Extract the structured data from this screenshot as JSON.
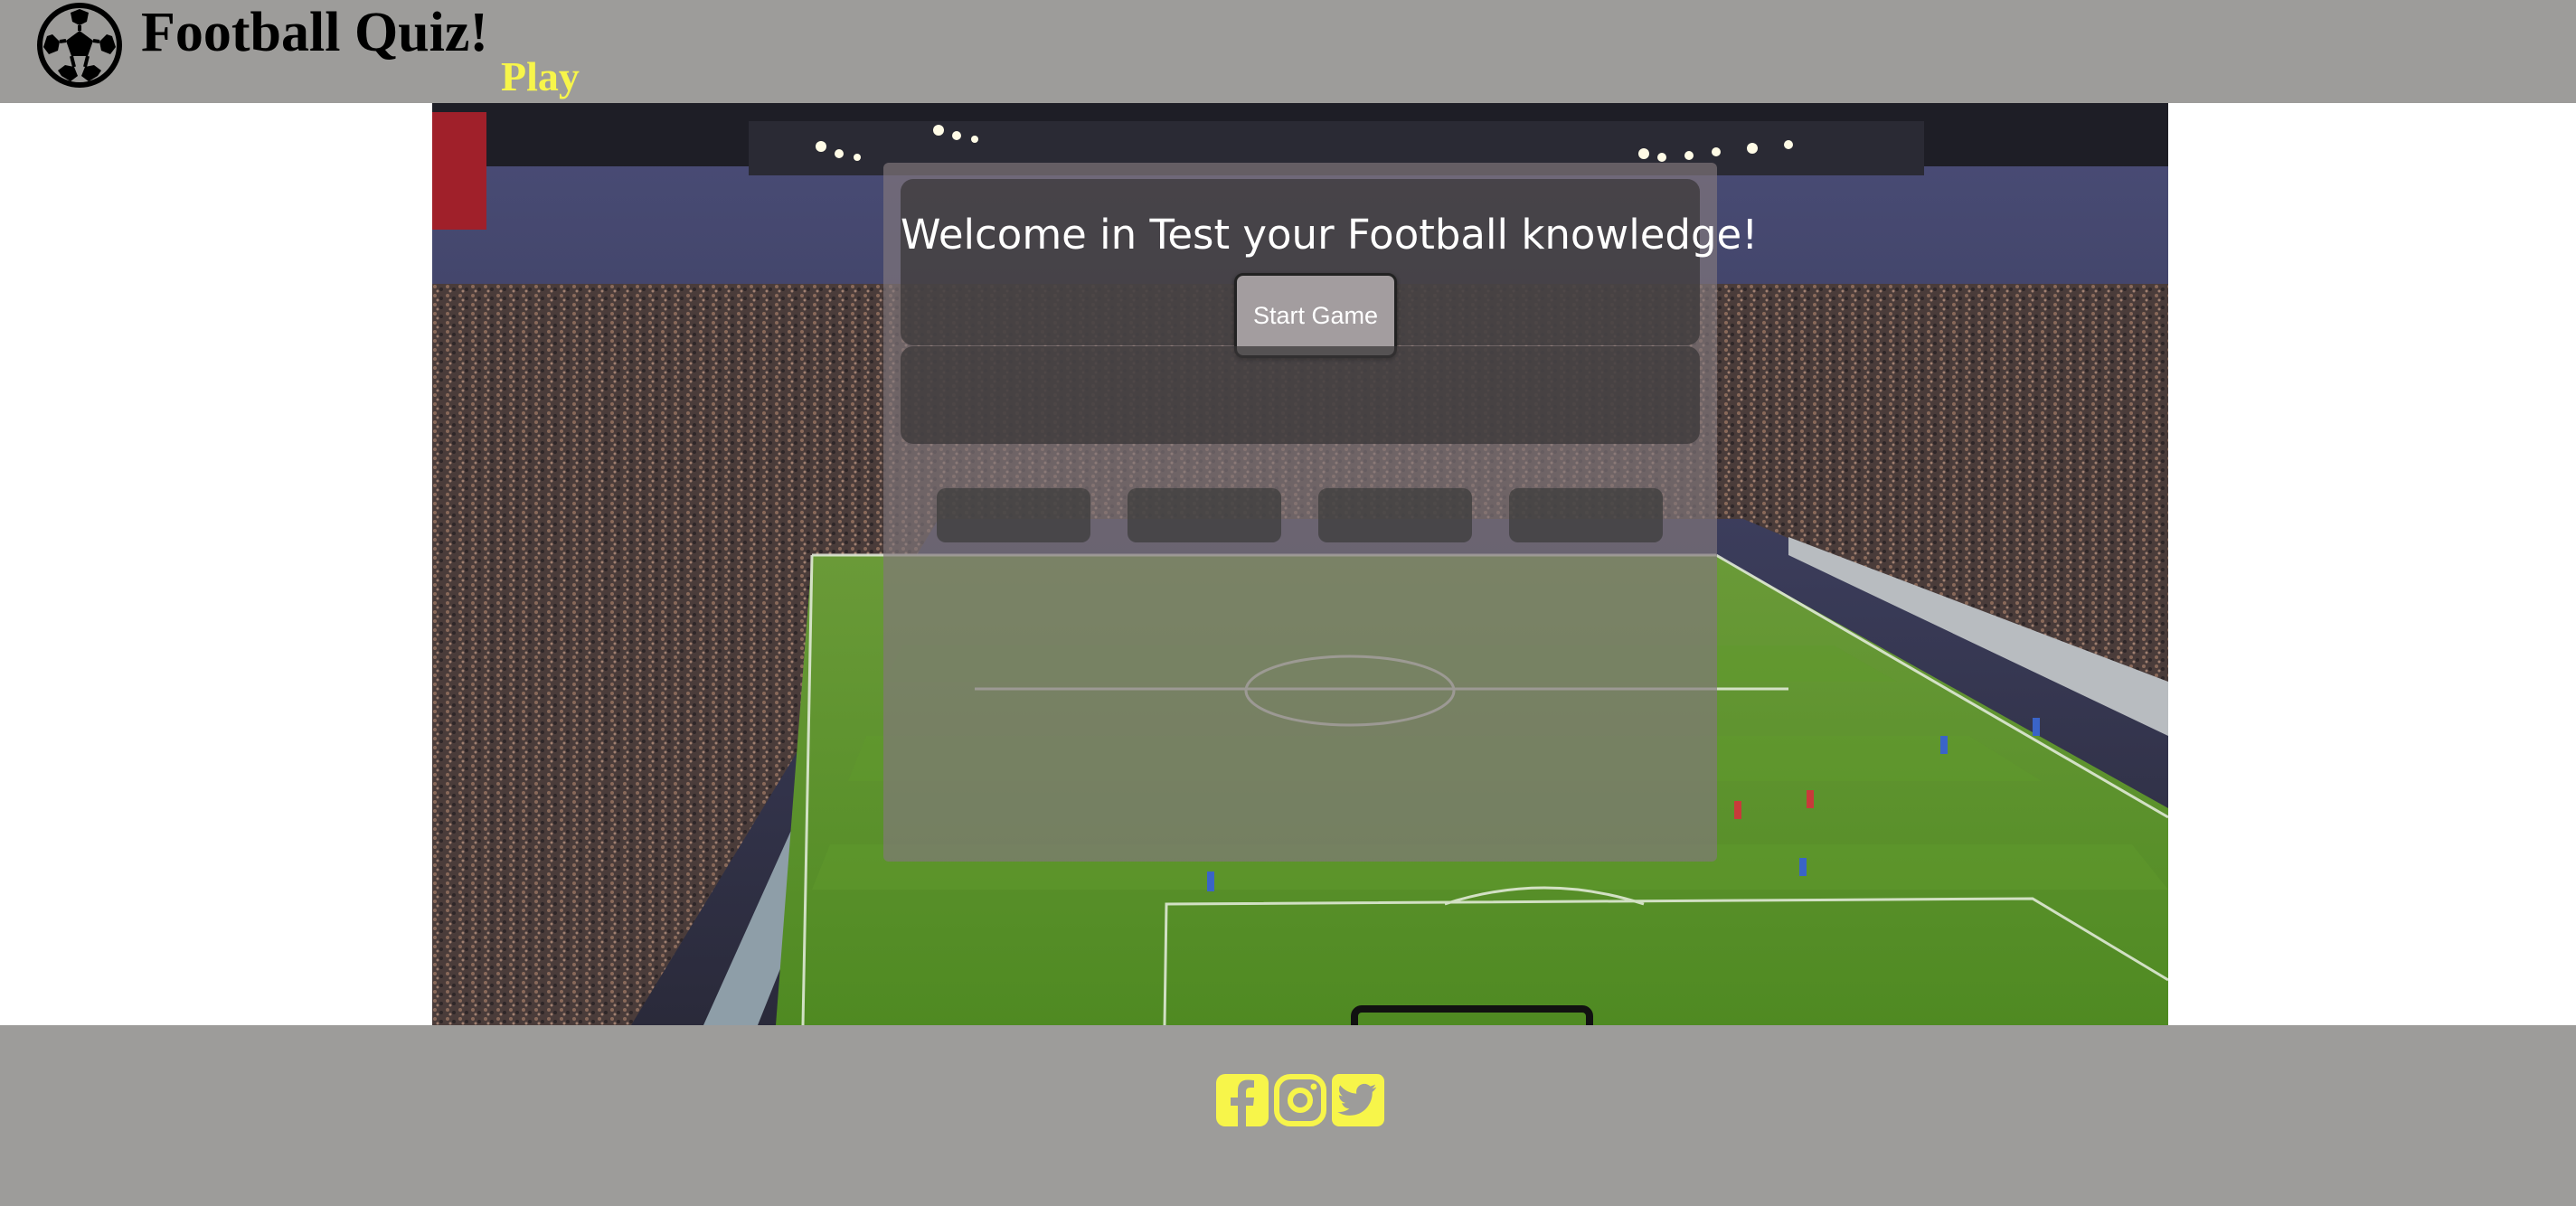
{
  "header": {
    "title": "Football Quiz!",
    "nav_play": "Play",
    "logo_icon": "soccer-ball-icon"
  },
  "quiz": {
    "welcome": "Welcome in Test your Football knowledge!",
    "start_label": "Start Game",
    "answer_text": "",
    "choices": [
      "",
      "",
      "",
      ""
    ]
  },
  "footer": {
    "social": [
      {
        "name": "facebook-icon"
      },
      {
        "name": "instagram-icon"
      },
      {
        "name": "twitter-icon"
      }
    ]
  },
  "colors": {
    "bar": "#9d9c9a",
    "accent": "#f7f54a",
    "button": "#a39d9f"
  }
}
